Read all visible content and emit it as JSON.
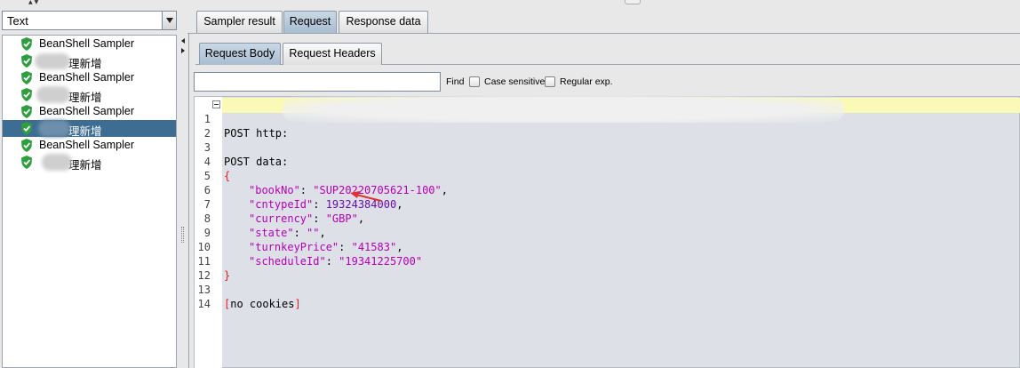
{
  "left_panel": {
    "combo_value": "Text",
    "tree": [
      {
        "label": "BeanShell Sampler",
        "selected": false
      },
      {
        "label": "理新增",
        "selected": false
      },
      {
        "label": "BeanShell Sampler",
        "selected": false
      },
      {
        "label": "理新增",
        "selected": false
      },
      {
        "label": "BeanShell Sampler",
        "selected": false
      },
      {
        "label": "理新增",
        "selected": true
      },
      {
        "label": "BeanShell Sampler",
        "selected": false
      },
      {
        "label": "理新增",
        "selected": false
      }
    ]
  },
  "result_tabs": [
    "Sampler result",
    "Request",
    "Response data"
  ],
  "active_result_tab": "Request",
  "request_tabs": [
    "Request Body",
    "Request Headers"
  ],
  "active_request_tab": "Request Body",
  "search": {
    "value": "",
    "find_label": "Find",
    "case_sensitive_label": "Case sensitive",
    "regex_label": "Regular exp."
  },
  "editor": {
    "line_numbers": [
      "1",
      "2",
      "3",
      "4",
      "5",
      "6",
      "7",
      "8",
      "9",
      "10",
      "11",
      "12",
      "13",
      "14"
    ],
    "lines": {
      "l1": "POST http:",
      "l3": "POST data:",
      "l4": "{",
      "l5_key": "\"bookNo\"",
      "l5_val": "\"SUP20220705621-100\"",
      "l6_key": "\"cntypeId\"",
      "l6_val": "19324384000",
      "l7_key": "\"currency\"",
      "l7_val": "\"GBP\"",
      "l8_key": "\"state\"",
      "l8_val": "\"\"",
      "l9_key": "\"turnkeyPrice\"",
      "l9_val": "\"41583\"",
      "l10_key": "\"scheduleId\"",
      "l10_val": "\"19341225700\"",
      "l11": "}",
      "l13_open": "[",
      "l13_text": "no cookies",
      "l13_close": "]"
    }
  },
  "colors": {
    "selection": "#3d6d93",
    "highlight_line": "#fafab6",
    "json_key": "#b400b4",
    "json_number": "#6a0dad",
    "brace": "#e02020",
    "annotation_arrow": "#e03030"
  }
}
